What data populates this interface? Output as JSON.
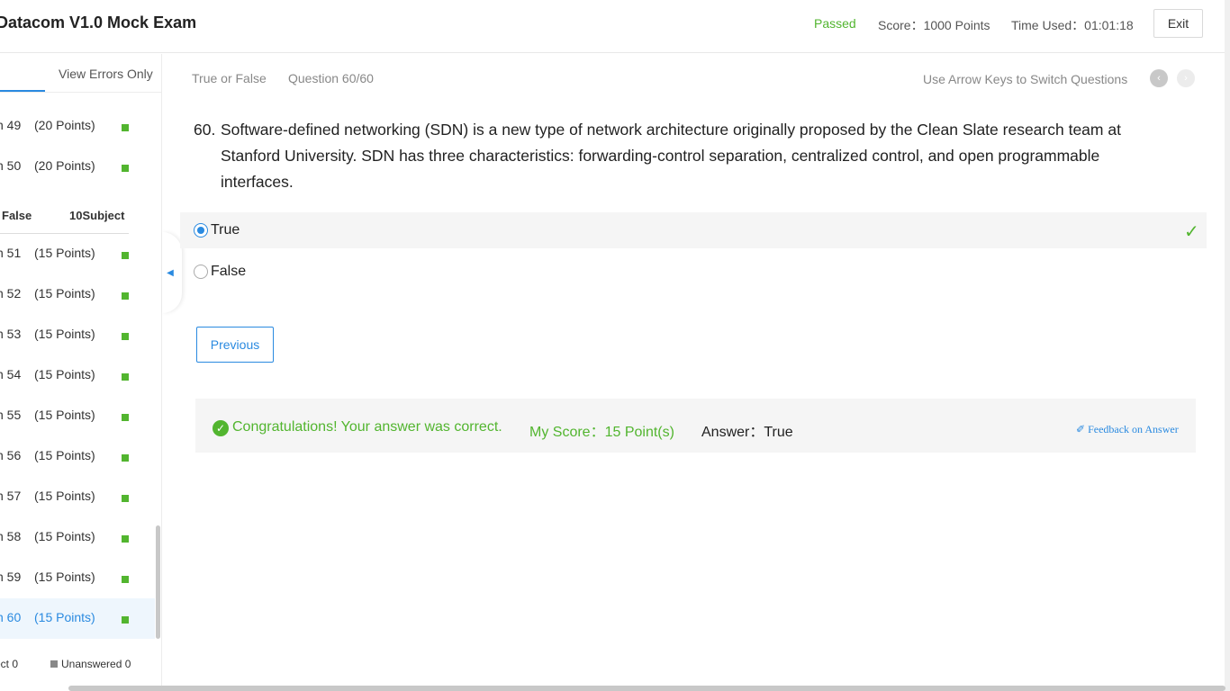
{
  "header": {
    "title": "Datacom V1.0 Mock Exam",
    "status": "Passed",
    "score": "Score：1000 Points",
    "time_used": "Time Used：01:01:18",
    "exit_label": "Exit"
  },
  "sidebar": {
    "tab_errors": "View Errors Only",
    "items_top": [
      {
        "label": "n 49",
        "points": "(20 Points)"
      },
      {
        "label": "n 50",
        "points": "(20 Points)"
      }
    ],
    "section": {
      "name": "False",
      "count": "10Subject"
    },
    "items": [
      {
        "label": "n 51",
        "points": "(15 Points)"
      },
      {
        "label": "n 52",
        "points": "(15 Points)"
      },
      {
        "label": "n 53",
        "points": "(15 Points)"
      },
      {
        "label": "n 54",
        "points": "(15 Points)"
      },
      {
        "label": "n 55",
        "points": "(15 Points)"
      },
      {
        "label": "n 56",
        "points": "(15 Points)"
      },
      {
        "label": "n 57",
        "points": "(15 Points)"
      },
      {
        "label": "n 58",
        "points": "(15 Points)"
      },
      {
        "label": "n 59",
        "points": "(15 Points)"
      },
      {
        "label": "n 60",
        "points": "(15 Points)"
      }
    ],
    "legend": {
      "correct": "ect 0",
      "unanswered": "Unanswered 0"
    }
  },
  "main": {
    "question_type": "True or False",
    "question_number": "Question 60/60",
    "hint": "Use Arrow Keys to Switch Questions",
    "question_index": "60.",
    "question_text": "Software-defined networking (SDN) is a new type of network architecture originally proposed by the Clean Slate research team at Stanford University. SDN has three characteristics: forwarding-control separation, centralized control, and open programmable interfaces.",
    "options": [
      {
        "label": "True",
        "selected": true,
        "correct": true
      },
      {
        "label": "False",
        "selected": false,
        "correct": false
      }
    ],
    "previous_label": "Previous",
    "result": {
      "congrats": "Congratulations! Your answer was correct.",
      "my_score": "My Score：15 Point(s)",
      "answer": "Answer：True",
      "feedback": "Feedback on Answer"
    }
  },
  "colors": {
    "accent": "#2a8ae0",
    "success": "#52b52f"
  }
}
